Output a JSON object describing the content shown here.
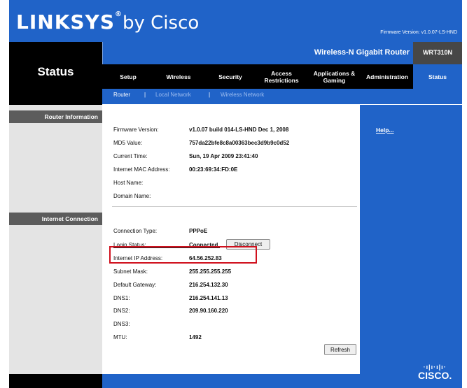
{
  "header": {
    "logo_main": "LINKSYS",
    "logo_reg": "®",
    "logo_by": "by Cisco",
    "firmware_version_top": "Firmware Version: v1.0.07-LS-HND",
    "product_name": "Wireless-N Gigabit Router",
    "model": "WRT310N"
  },
  "page_title": "Status",
  "nav": {
    "items": [
      {
        "label": "Setup"
      },
      {
        "label": "Wireless"
      },
      {
        "label": "Security"
      },
      {
        "label": "Access\nRestrictions"
      },
      {
        "label": "Applications &\nGaming"
      },
      {
        "label": "Administration"
      },
      {
        "label": "Status"
      }
    ],
    "active": "Status"
  },
  "subnav": {
    "items": [
      {
        "label": "Router"
      },
      {
        "label": "Local Network"
      },
      {
        "label": "Wireless Network"
      }
    ],
    "separator": "|",
    "active": "Router"
  },
  "sections": {
    "router_info": "Router Information",
    "internet_connection": "Internet Connection"
  },
  "router_info": [
    {
      "label": "Firmware Version:",
      "value": "v1.0.07 build 014-LS-HND  Dec 1, 2008"
    },
    {
      "label": "MD5 Value:",
      "value": "757da22bfe8c8a00363bec3d9b9c0d52"
    },
    {
      "label": "Current Time:",
      "value": "Sun, 19 Apr 2009 23:41:40"
    },
    {
      "label": "Internet MAC Address:",
      "value": "00:23:69:34:FD:0E"
    },
    {
      "label": "Host Name:",
      "value": ""
    },
    {
      "label": "Domain Name:",
      "value": ""
    }
  ],
  "internet": [
    {
      "label": "Connection Type:",
      "value": "PPPoE"
    },
    {
      "label": "Login Status:",
      "value": "Connected"
    },
    {
      "label": "Internet IP Address:",
      "value": "64.56.252.83"
    },
    {
      "label": "Subnet Mask:",
      "value": "255.255.255.255"
    },
    {
      "label": "Default Gateway:",
      "value": "216.254.132.30"
    },
    {
      "label": "DNS1:",
      "value": "216.254.141.13"
    },
    {
      "label": "DNS2:",
      "value": "209.90.160.220"
    },
    {
      "label": "DNS3:",
      "value": ""
    },
    {
      "label": "MTU:",
      "value": "1492"
    }
  ],
  "buttons": {
    "disconnect": "Disconnect",
    "refresh": "Refresh"
  },
  "help_link": "Help...",
  "footer": {
    "cisco_bars": "·ı|ı·ı|ı·",
    "cisco_word": "CISCO."
  },
  "colors": {
    "brand_blue": "#2063c8",
    "nav_black": "#000000",
    "section_gray": "#5c5c5c",
    "highlight_red": "#d0101d"
  }
}
